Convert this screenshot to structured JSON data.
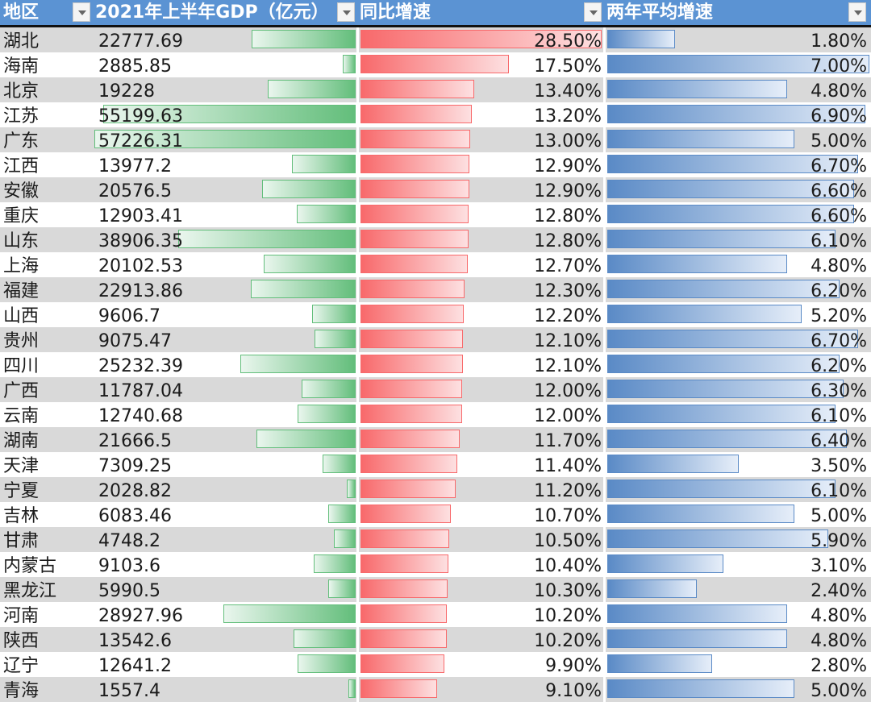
{
  "headers": {
    "region": "地区",
    "gdp": "2021年上半年GDP（亿元）",
    "yoy": "同比增速",
    "avg2y": "两年平均增速"
  },
  "colors": {
    "header_bg": "#5b93d3",
    "gdp_bar": "#63be7b",
    "yoy_bar": "#f8696b",
    "avg_bar": "#5a8ac6",
    "row_shade": "#d9d9d9"
  },
  "rows": [
    {
      "region": "湖北",
      "gdp": "22777.69",
      "yoy": "28.50%",
      "avg": "1.80%"
    },
    {
      "region": "海南",
      "gdp": "2885.85",
      "yoy": "17.50%",
      "avg": "7.00%"
    },
    {
      "region": "北京",
      "gdp": "19228",
      "yoy": "13.40%",
      "avg": "4.80%"
    },
    {
      "region": "江苏",
      "gdp": "55199.63",
      "yoy": "13.20%",
      "avg": "6.90%"
    },
    {
      "region": "广东",
      "gdp": "57226.31",
      "yoy": "13.00%",
      "avg": "5.00%"
    },
    {
      "region": "江西",
      "gdp": "13977.2",
      "yoy": "12.90%",
      "avg": "6.70%"
    },
    {
      "region": "安徽",
      "gdp": "20576.5",
      "yoy": "12.90%",
      "avg": "6.60%"
    },
    {
      "region": "重庆",
      "gdp": "12903.41",
      "yoy": "12.80%",
      "avg": "6.60%"
    },
    {
      "region": "山东",
      "gdp": "38906.35",
      "yoy": "12.80%",
      "avg": "6.10%"
    },
    {
      "region": "上海",
      "gdp": "20102.53",
      "yoy": "12.70%",
      "avg": "4.80%"
    },
    {
      "region": "福建",
      "gdp": "22913.86",
      "yoy": "12.30%",
      "avg": "6.20%"
    },
    {
      "region": "山西",
      "gdp": "9606.7",
      "yoy": "12.20%",
      "avg": "5.20%"
    },
    {
      "region": "贵州",
      "gdp": "9075.47",
      "yoy": "12.10%",
      "avg": "6.70%"
    },
    {
      "region": "四川",
      "gdp": "25232.39",
      "yoy": "12.10%",
      "avg": "6.20%"
    },
    {
      "region": "广西",
      "gdp": "11787.04",
      "yoy": "12.00%",
      "avg": "6.30%"
    },
    {
      "region": "云南",
      "gdp": "12740.68",
      "yoy": "12.00%",
      "avg": "6.10%"
    },
    {
      "region": "湖南",
      "gdp": "21666.5",
      "yoy": "11.70%",
      "avg": "6.40%"
    },
    {
      "region": "天津",
      "gdp": "7309.25",
      "yoy": "11.40%",
      "avg": "3.50%"
    },
    {
      "region": "宁夏",
      "gdp": "2028.82",
      "yoy": "11.20%",
      "avg": "6.10%"
    },
    {
      "region": "吉林",
      "gdp": "6083.46",
      "yoy": "10.70%",
      "avg": "5.00%"
    },
    {
      "region": "甘肃",
      "gdp": "4748.2",
      "yoy": "10.50%",
      "avg": "5.90%"
    },
    {
      "region": "内蒙古",
      "gdp": "9103.6",
      "yoy": "10.40%",
      "avg": "3.10%"
    },
    {
      "region": "黑龙江",
      "gdp": "5990.5",
      "yoy": "10.30%",
      "avg": "2.40%"
    },
    {
      "region": "河南",
      "gdp": "28927.96",
      "yoy": "10.20%",
      "avg": "4.80%"
    },
    {
      "region": "陕西",
      "gdp": "13542.6",
      "yoy": "10.20%",
      "avg": "4.80%"
    },
    {
      "region": "辽宁",
      "gdp": "12641.2",
      "yoy": "9.90%",
      "avg": "2.80%"
    },
    {
      "region": "青海",
      "gdp": "1557.4",
      "yoy": "9.10%",
      "avg": "5.00%"
    }
  ]
}
